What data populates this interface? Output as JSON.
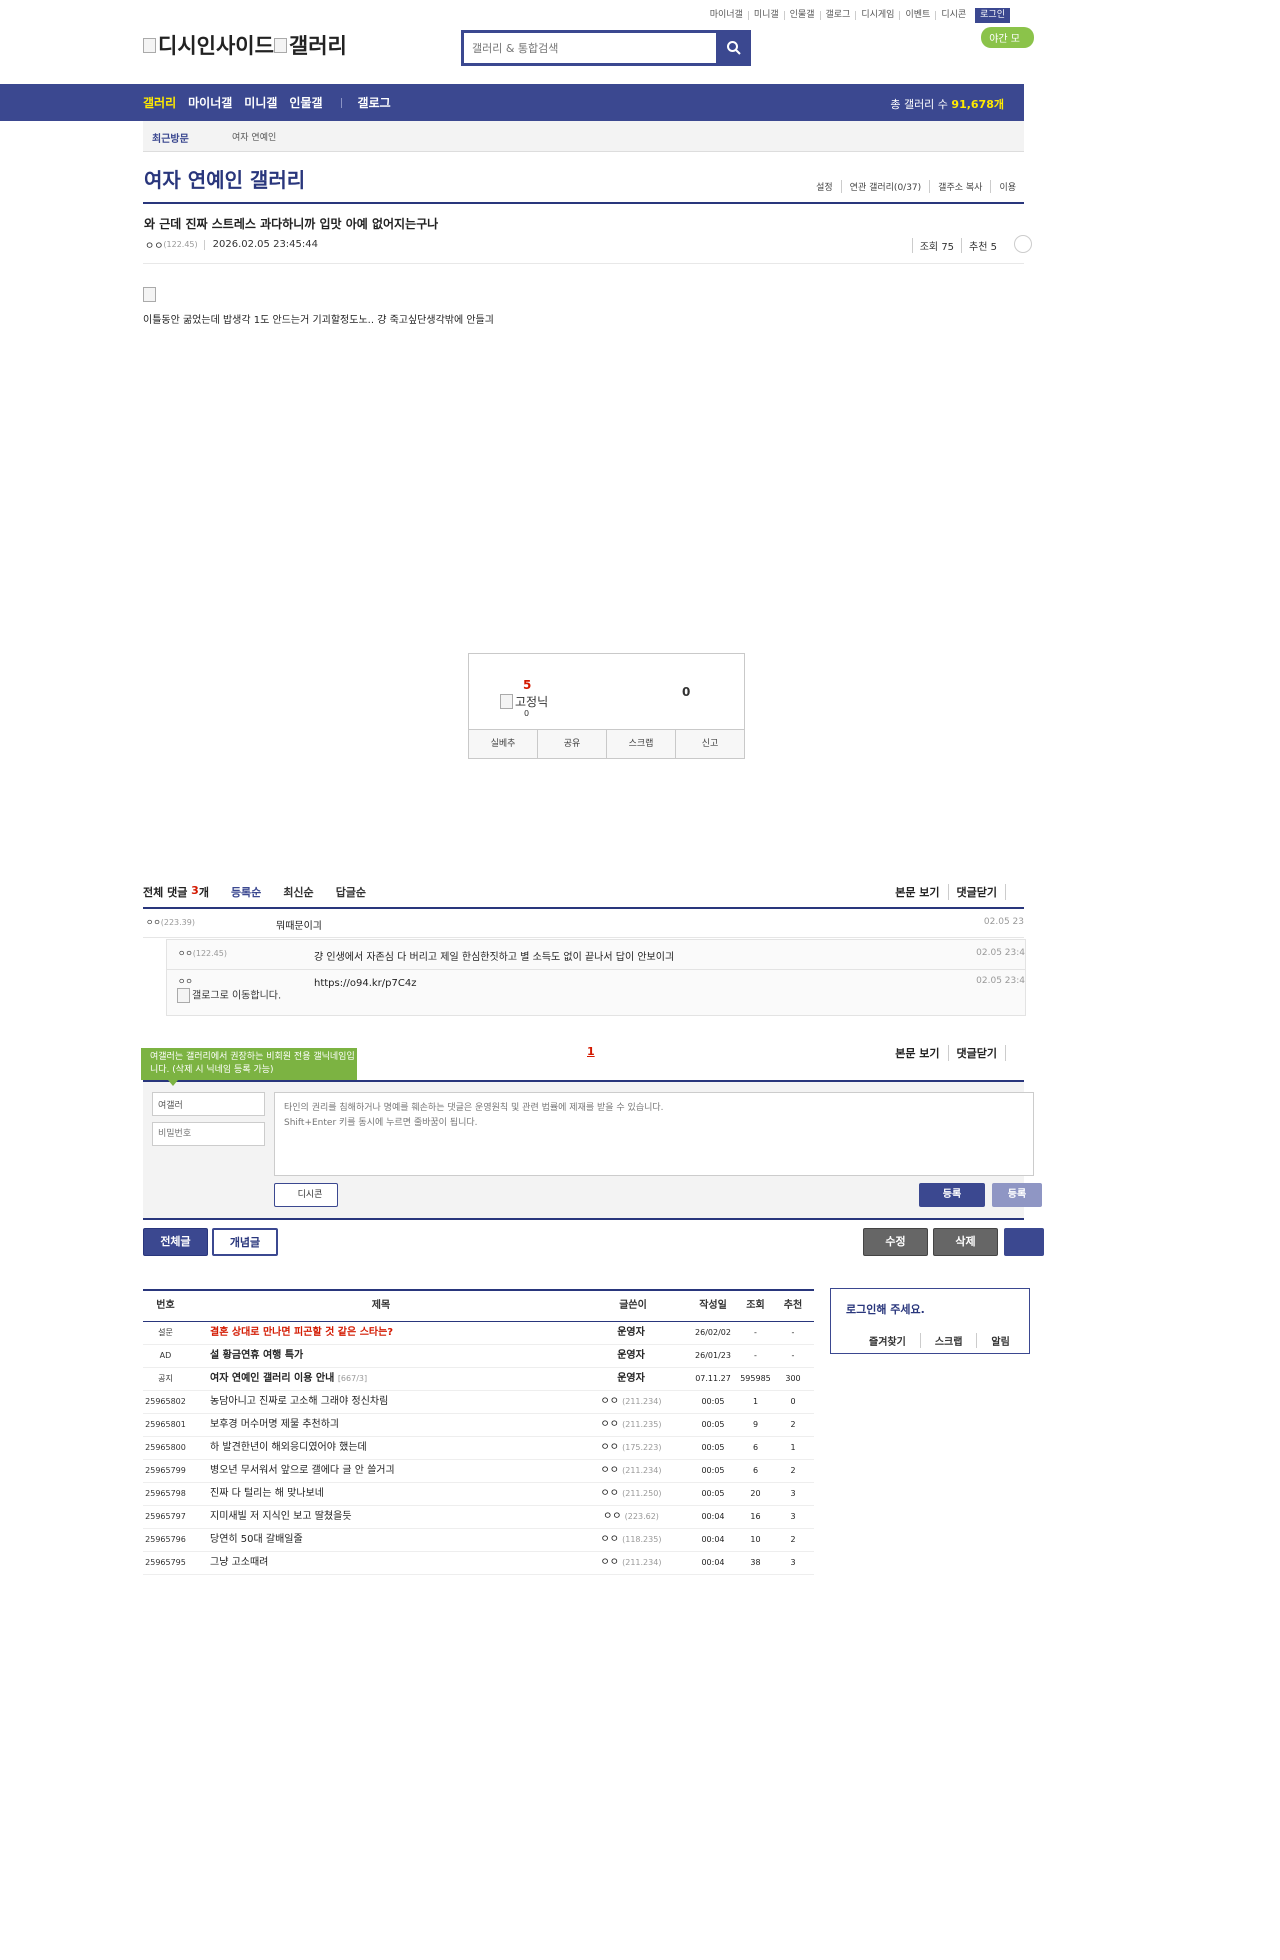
{
  "util_menu": [
    "마이너갤",
    "미니갤",
    "인물갤",
    "갤로그",
    "디시게임",
    "이벤트",
    "디시콘"
  ],
  "login_label": "로그인",
  "night_mode": "야간 모",
  "logo": {
    "main": "디시인사이드",
    "sub": "갤러리"
  },
  "search": {
    "placeholder": "갤러리 & 통합검색"
  },
  "nav": {
    "items": [
      "갤러리",
      "마이너갤",
      "미니갤",
      "인물갤",
      "갤로그"
    ],
    "total_label": "총 갤러리 수",
    "total_count": "91,678개"
  },
  "recent": {
    "label": "최근방문",
    "item": "여자 연예인"
  },
  "gallery": {
    "title": "여자 연예인 갤러리",
    "tools": [
      "설정",
      "연관 갤러리(0/37)",
      "갤주소 복사",
      "이용"
    ]
  },
  "post": {
    "title": "와 근데 진짜 스트레스 과다하니까 입맛 아예 없어지는구나",
    "writer": "ㅇㅇ",
    "ip": "(122.45)",
    "date": "2026.02.05 23:45:44",
    "views_label": "조회 75",
    "rec_label": "추천 5",
    "body": "이틀동안 굶었는데 밥생각 1도 안드는거 기괴할정도노.. 걍 죽고싶단생각밖에 안들긔"
  },
  "recommend": {
    "up": "5",
    "fixed_label": "고정닉",
    "fixed_count": "0",
    "down": "0",
    "buttons": [
      "실베추",
      "공유",
      "스크랩",
      "신고"
    ]
  },
  "comments": {
    "total_label": "전체 댓글",
    "count": "3",
    "count_unit": "개",
    "sorts": [
      "등록순",
      "최신순",
      "답글순"
    ],
    "right_links": [
      "본문 보기",
      "댓글닫기"
    ],
    "items": [
      {
        "writer": "ㅇㅇ",
        "ip": "(223.39)",
        "text": "뭐때문이긔",
        "time": "02.05 23"
      },
      {
        "writer": "ㅇㅇ",
        "ip": "(122.45)",
        "text": "걍 인생에서 자존심 다 버리고 제일 한심한짓하고 별 소득도 없이 끝나서 답이 안보이긔",
        "time": "02.05 23:4"
      },
      {
        "writer": "ㅇㅇ",
        "img_alt": "갤로그로 이동합니다.",
        "text": "https://o94.kr/p7C4z",
        "time": "02.05 23:4"
      }
    ],
    "page": "1"
  },
  "write": {
    "tip": "여갤러는 갤러리에서 권장하는 비회원 전용 갤닉네임입니다. (삭제 시 닉네임 등록 가능)",
    "nick_value": "여갤러",
    "pw_placeholder": "비밀번호",
    "textarea_placeholder": "타인의 권리를 침해하거나 명예를 훼손하는 댓글은 운영원칙 및 관련 법률에 제재를 받을 수 있습니다.\nShift+Enter 키를 동시에 누르면 줄바꿈이 됩니다.",
    "dccon": "디시콘",
    "submit": "등록",
    "submit2": "등록"
  },
  "board_buttons": {
    "all": "전체글",
    "concept": "개념글",
    "edit": "수정",
    "delete": "삭제"
  },
  "list": {
    "headers": {
      "no": "번호",
      "title": "제목",
      "writer": "글쓴이",
      "date": "작성일",
      "views": "조회",
      "rec": "추천"
    },
    "rows": [
      {
        "no": "설문",
        "title": "결혼 상대로 만나면 피곤할 것 같은 스타는?",
        "writer": "운영자",
        "ip": "",
        "date": "26/02/02",
        "views": "-",
        "rec": "-",
        "type": "survey"
      },
      {
        "no": "AD",
        "title": "설 황금연휴 여행 특가",
        "writer": "운영자",
        "ip": "",
        "date": "26/01/23",
        "views": "-",
        "rec": "-",
        "type": "notice"
      },
      {
        "no": "공지",
        "title": "여자 연예인 갤러리 이용 안내",
        "count": "[667/3]",
        "writer": "운영자",
        "ip": "",
        "date": "07.11.27",
        "views": "595985",
        "rec": "300",
        "type": "notice"
      },
      {
        "no": "25965802",
        "title": "농담아니고 진짜로 고소해 그래야 정신차림",
        "writer": "ㅇㅇ",
        "ip": "(211.234)",
        "date": "00:05",
        "views": "1",
        "rec": "0",
        "type": "normal"
      },
      {
        "no": "25965801",
        "title": "보후경 머수머명 제물 추천하긔",
        "writer": "ㅇㅇ",
        "ip": "(211.235)",
        "date": "00:05",
        "views": "9",
        "rec": "2",
        "type": "normal"
      },
      {
        "no": "25965800",
        "title": "하 발견한년이 해외응디였어야 했는데",
        "writer": "ㅇㅇ",
        "ip": "(175.223)",
        "date": "00:05",
        "views": "6",
        "rec": "1",
        "type": "normal"
      },
      {
        "no": "25965799",
        "title": "병오년 무서워서 앞으로 갤에다 글 안 쓸거긔",
        "writer": "ㅇㅇ",
        "ip": "(211.234)",
        "date": "00:05",
        "views": "6",
        "rec": "2",
        "type": "normal"
      },
      {
        "no": "25965798",
        "title": "진짜 다 털리는 해 맞나보네",
        "writer": "ㅇㅇ",
        "ip": "(211.250)",
        "date": "00:05",
        "views": "20",
        "rec": "3",
        "type": "normal"
      },
      {
        "no": "25965797",
        "title": "지미새빌 저 지식인 보고 딸쳤을듯",
        "writer": "ㅇㅇ",
        "ip": "(223.62)",
        "date": "00:04",
        "views": "16",
        "rec": "3",
        "type": "normal"
      },
      {
        "no": "25965796",
        "title": "당연히 50대 갈배일줄",
        "writer": "ㅇㅇ",
        "ip": "(118.235)",
        "date": "00:04",
        "views": "10",
        "rec": "2",
        "type": "normal"
      },
      {
        "no": "25965795",
        "title": "그냥 고소때려",
        "writer": "ㅇㅇ",
        "ip": "(211.234)",
        "date": "00:04",
        "views": "38",
        "rec": "3",
        "type": "normal"
      }
    ]
  },
  "loginbox": {
    "title": "로그인해 주세요.",
    "links": [
      "즐겨찾기",
      "스크랩",
      "알림"
    ]
  }
}
